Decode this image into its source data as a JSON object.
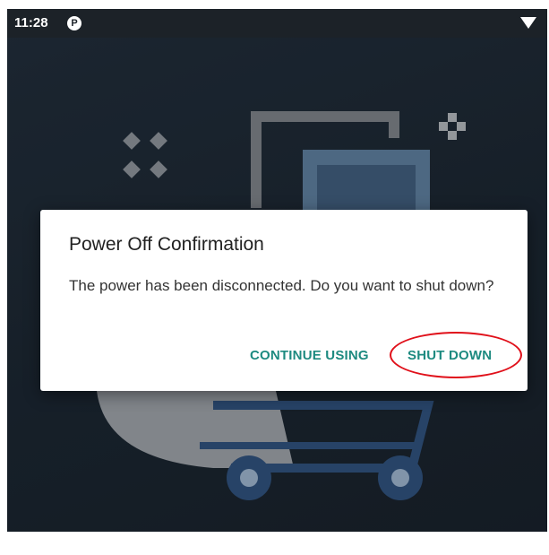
{
  "status_bar": {
    "time": "11:28",
    "app_icon": "notification-app-icon",
    "app_icon_glyph": "P",
    "signal_icon": "wifi-icon"
  },
  "dialog": {
    "title": "Power Off Confirmation",
    "message": "The power has been disconnected. Do you want to shut down?",
    "buttons": {
      "continue_label": "CONTINUE USING",
      "shutdown_label": "SHUT DOWN"
    }
  },
  "colors": {
    "button_text": "#1d8a80",
    "highlight": "#e0101a",
    "background": "#1f2a36"
  }
}
